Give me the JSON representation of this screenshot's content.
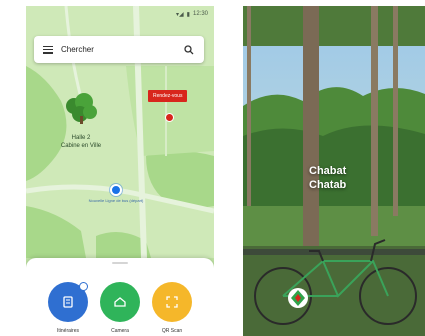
{
  "left_screen": {
    "status_time": "12:30",
    "search": {
      "label": "Chercher"
    },
    "map": {
      "marker_label": "Rendez-vous",
      "poi_label_line1": "Halle 2",
      "poi_label_line2": "Cabine en Ville",
      "user_label": "Nouvelle Ligne de bus (départ)"
    },
    "actions": [
      {
        "label": "Itinéraires",
        "color": "#2f6fd1",
        "icon": "route-icon"
      },
      {
        "label": "Camera",
        "color": "#2fb45a",
        "icon": "camera-icon"
      },
      {
        "label": "QR Scan",
        "color": "#f5b72a",
        "icon": "qr-scan-icon"
      }
    ]
  },
  "right_screen": {
    "overlay_line1": "Chabat",
    "overlay_line2": "Chatab"
  }
}
